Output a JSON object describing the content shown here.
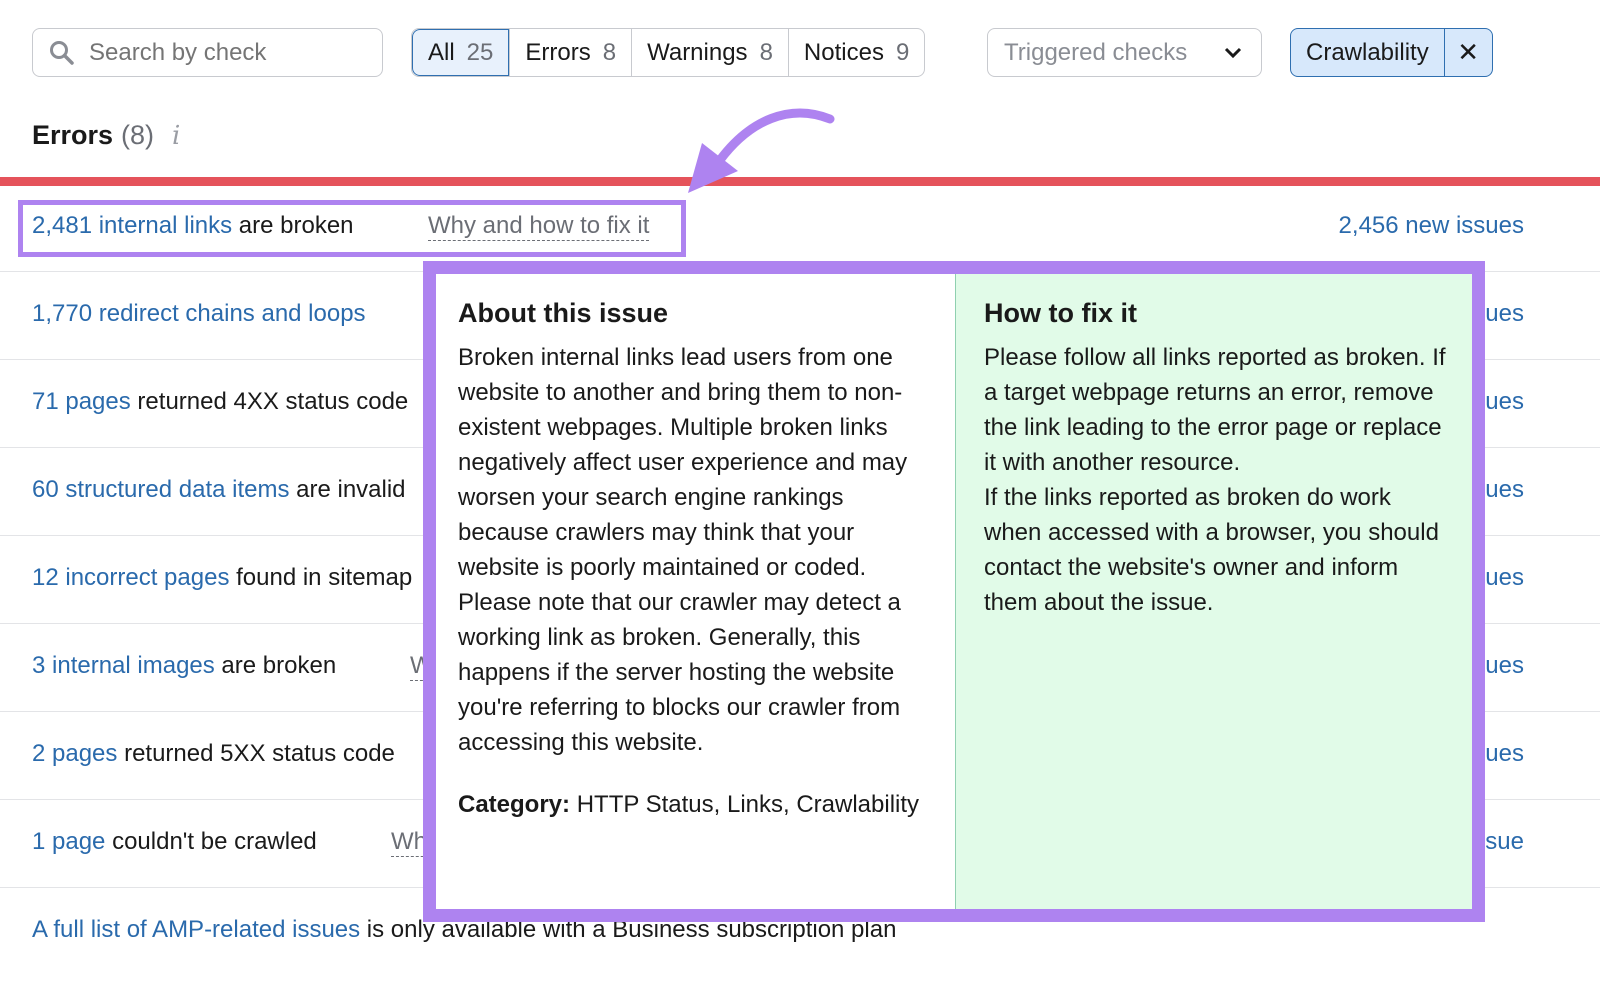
{
  "search": {
    "placeholder": "Search by check"
  },
  "filters": [
    {
      "label": "All",
      "count": "25"
    },
    {
      "label": "Errors",
      "count": "8"
    },
    {
      "label": "Warnings",
      "count": "8"
    },
    {
      "label": "Notices",
      "count": "9"
    }
  ],
  "dropdown": {
    "label": "Triggered checks"
  },
  "chip": {
    "label": "Crawlability",
    "close": "✕"
  },
  "section": {
    "title": "Errors",
    "count": "(8)",
    "info": "i"
  },
  "accent": {
    "error": "#e5535b",
    "highlight": "#ae83f0",
    "link": "#2a6aac"
  },
  "rows": [
    {
      "link": "2,481 internal links",
      "text": " are broken",
      "why": "Why and how to fix it",
      "right": "2,456 new issues"
    },
    {
      "link": "1,770 redirect chains and loops",
      "text": "",
      "right": "ues"
    },
    {
      "link": "71 pages",
      "text": " returned 4XX status code",
      "right": "ues"
    },
    {
      "link": "60 structured data items",
      "text": " are invalid",
      "right": "ues"
    },
    {
      "link": "12 incorrect pages",
      "text": " found in sitemap",
      "right": "ues"
    },
    {
      "link": "3 internal images",
      "text": " are broken",
      "why": "Why and how to fix it",
      "right": "ues"
    },
    {
      "link": "2 pages",
      "text": " returned 5XX status code",
      "right": "ues"
    },
    {
      "link": "1 page",
      "text": " couldn't be crawled",
      "why": "Why and how to fix it",
      "right": "sue"
    }
  ],
  "amp": {
    "link": "A full list of AMP-related issues",
    "text": " is only available with a Business subscription plan"
  },
  "popup": {
    "about_title": "About this issue",
    "about_text": "Broken internal links lead users from one website to another and bring them to non-existent webpages. Multiple broken links negatively affect user experience and may worsen your search engine rankings because crawlers may think that your website is poorly maintained or coded.",
    "about_note": "Please note that our crawler may detect a working link as broken. Generally, this happens if the server hosting the website you're referring to blocks our crawler from accessing this website.",
    "category_label": "Category:",
    "category_value": " HTTP Status, Links, Crawlability",
    "fix_title": "How to fix it",
    "fix_text": "Please follow all links reported as broken. If a target webpage returns an error, remove the link leading to the error page or replace it with another resource.",
    "fix_note": "If the links reported as broken do work when accessed with a browser, you should contact the website's owner and inform them about the issue."
  }
}
